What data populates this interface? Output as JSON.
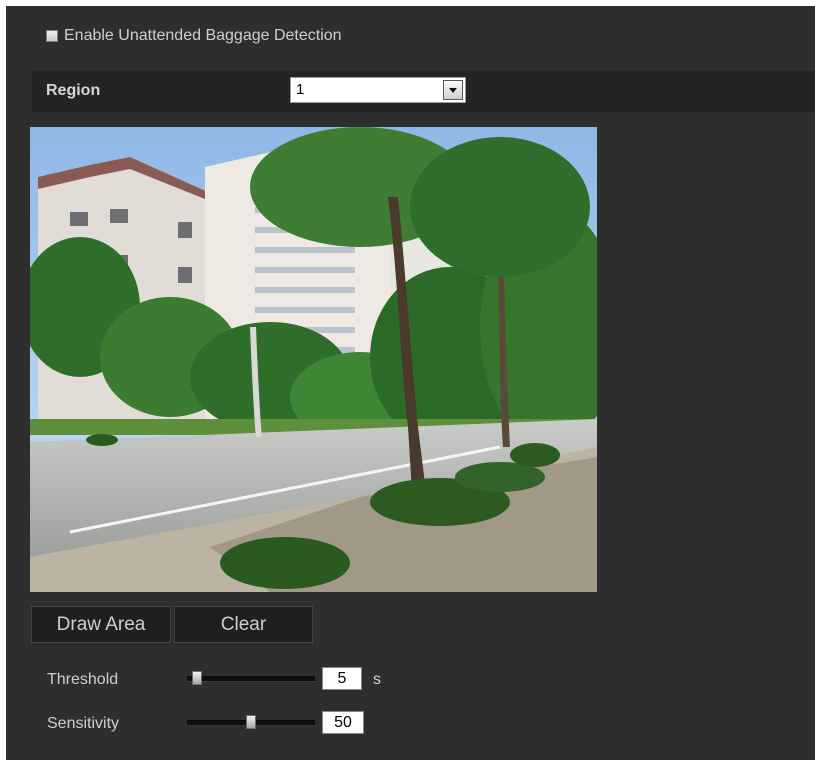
{
  "enable": {
    "label": "Enable Unattended Baggage Detection",
    "checked": false
  },
  "region": {
    "label": "Region",
    "value": "1"
  },
  "preview": {
    "alt": "camera-preview"
  },
  "buttons": {
    "draw_area": "Draw Area",
    "clear": "Clear"
  },
  "threshold": {
    "label": "Threshold",
    "value": "5",
    "unit": "s",
    "level": 0.04
  },
  "sensitivity": {
    "label": "Sensitivity",
    "value": "50",
    "level": 0.5
  },
  "colors": {
    "panel": "#2e2e2e",
    "header_bar": "#242424",
    "text": "#cfcfcf"
  }
}
